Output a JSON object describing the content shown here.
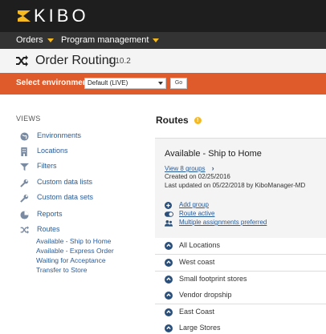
{
  "brand": {
    "name": "KIBO",
    "accent": "#f5b921"
  },
  "menu": {
    "items": [
      {
        "label": "Orders"
      },
      {
        "label": "Program management"
      }
    ]
  },
  "header": {
    "title": "Order Routing",
    "version": "1.10.2"
  },
  "environment": {
    "label": "Select environment",
    "selected": "Default (LIVE)",
    "go_label": "Go",
    "bar_color": "#e05b2b"
  },
  "sidebar": {
    "heading": "VIEWS",
    "items": [
      {
        "label": "Environments",
        "icon": "globe-icon"
      },
      {
        "label": "Locations",
        "icon": "building-icon"
      },
      {
        "label": "Filters",
        "icon": "filter-icon"
      },
      {
        "label": "Custom data lists",
        "icon": "wrench-icon"
      },
      {
        "label": "Custom data sets",
        "icon": "wrench-icon"
      },
      {
        "label": "Reports",
        "icon": "pie-chart-icon"
      },
      {
        "label": "Routes",
        "icon": "shuffle-icon"
      }
    ],
    "routes": [
      "Available - Ship to Home",
      "Available - Express Order",
      "Waiting for Acceptance",
      "Transfer to Store"
    ]
  },
  "main": {
    "title": "Routes",
    "card": {
      "title": "Available - Ship to Home",
      "view_groups": "View 8 groups",
      "created": "Created on 02/25/2016",
      "updated": "Last updated on 05/22/2018 by KiboManager-MD",
      "actions": [
        {
          "label": "Add group",
          "icon": "plus-circle-icon"
        },
        {
          "label": "Route active",
          "icon": "toggle-icon"
        },
        {
          "label": "Multiple assignments preferred",
          "icon": "users-icon"
        }
      ]
    },
    "groups": [
      "All Locations",
      "West coast",
      "Small footprint stores",
      "Vendor dropship",
      "East Coast",
      "Large Stores"
    ]
  }
}
